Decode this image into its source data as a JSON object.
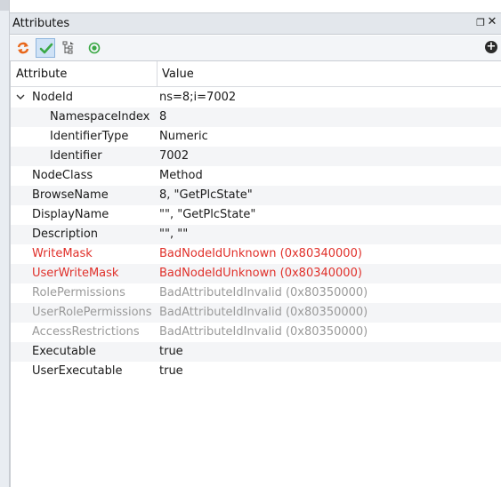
{
  "panel": {
    "title": "Attributes",
    "float_icon": "float-window-icon",
    "close_icon": "close-icon"
  },
  "toolbar": {
    "buttons": [
      {
        "icon": "refresh-icon",
        "active": false
      },
      {
        "icon": "checkmark-icon",
        "active": true
      },
      {
        "icon": "tree-icon",
        "active": false
      },
      {
        "icon": "radio-target-icon",
        "active": false
      }
    ],
    "add_icon": "add-icon"
  },
  "grid": {
    "columns": [
      "Attribute",
      "Value"
    ],
    "rows": [
      {
        "attr": "NodeId",
        "value": "ns=8;i=7002",
        "level": 0,
        "expanded": true,
        "style": "normal"
      },
      {
        "attr": "NamespaceIndex",
        "value": "8",
        "level": 1,
        "style": "normal"
      },
      {
        "attr": "IdentifierType",
        "value": "Numeric",
        "level": 1,
        "style": "normal"
      },
      {
        "attr": "Identifier",
        "value": "7002",
        "level": 1,
        "style": "normal"
      },
      {
        "attr": "NodeClass",
        "value": "Method",
        "level": 0,
        "style": "normal"
      },
      {
        "attr": "BrowseName",
        "value": "8, \"GetPlcState\"",
        "level": 0,
        "style": "normal"
      },
      {
        "attr": "DisplayName",
        "value": "\"\", \"GetPlcState\"",
        "level": 0,
        "style": "normal"
      },
      {
        "attr": "Description",
        "value": "\"\", \"\"",
        "level": 0,
        "style": "normal"
      },
      {
        "attr": "WriteMask",
        "value": "BadNodeIdUnknown (0x80340000)",
        "level": 0,
        "style": "error"
      },
      {
        "attr": "UserWriteMask",
        "value": "BadNodeIdUnknown (0x80340000)",
        "level": 0,
        "style": "error"
      },
      {
        "attr": "RolePermissions",
        "value": "BadAttributeIdInvalid (0x80350000)",
        "level": 0,
        "style": "disabled"
      },
      {
        "attr": "UserRolePermissions",
        "value": "BadAttributeIdInvalid (0x80350000)",
        "level": 0,
        "style": "disabled"
      },
      {
        "attr": "AccessRestrictions",
        "value": "BadAttributeIdInvalid (0x80350000)",
        "level": 0,
        "style": "disabled"
      },
      {
        "attr": "Executable",
        "value": "true",
        "level": 0,
        "style": "normal"
      },
      {
        "attr": "UserExecutable",
        "value": "true",
        "level": 0,
        "style": "normal"
      }
    ]
  },
  "colors": {
    "error": "#e0302a",
    "disabled": "#9a9a9a",
    "accent": "#cfe2f6"
  }
}
